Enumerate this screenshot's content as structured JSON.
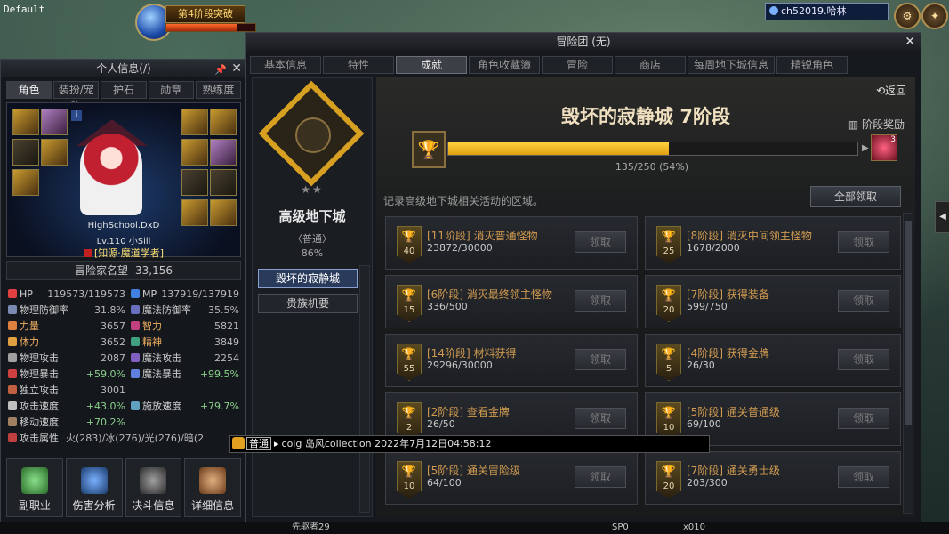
{
  "hud": {
    "profile": "Default",
    "banner": "第4阶段突破",
    "server": "ch52019.哈林"
  },
  "char_panel": {
    "title": "个人信息(/)",
    "tabs": [
      "角色",
      "装扮/宠物",
      "护石",
      "勋章",
      "熟练度"
    ],
    "name": "HighSchool.DxD",
    "level": "Lv.110 小Sill",
    "char_title": "[知源·魔道学者]",
    "fame_label": "冒险家名望",
    "fame_value": "33,156",
    "stats": [
      {
        "label": "HP",
        "value": "119573/119573",
        "icon": "heart-icon"
      },
      {
        "label": "MP",
        "value": "137919/137919",
        "icon": "mana-icon"
      },
      {
        "label": "物理防御率",
        "value": "31.8%",
        "icon": "shield-icon"
      },
      {
        "label": "魔法防御率",
        "value": "35.5%",
        "icon": "magic-shield-icon"
      },
      {
        "label": "力量",
        "value": "3657",
        "icon": "strength-icon"
      },
      {
        "label": "智力",
        "value": "5821",
        "icon": "intelligence-icon"
      },
      {
        "label": "体力",
        "value": "3652",
        "icon": "vitality-icon"
      },
      {
        "label": "精神",
        "value": "3849",
        "icon": "spirit-icon"
      },
      {
        "label": "物理攻击",
        "value": "2087",
        "icon": "sword-icon"
      },
      {
        "label": "魔法攻击",
        "value": "2254",
        "icon": "staff-icon"
      },
      {
        "label": "物理暴击",
        "value": "+59.0%",
        "icon": "crit-icon"
      },
      {
        "label": "魔法暴击",
        "value": "+99.5%",
        "icon": "magic-crit-icon"
      },
      {
        "label": "独立攻击",
        "value": "3001",
        "icon": "independent-attack-icon"
      },
      {
        "label": "",
        "value": "",
        "icon": ""
      },
      {
        "label": "攻击速度",
        "value": "+43.0%",
        "icon": "attack-speed-icon"
      },
      {
        "label": "施放速度",
        "value": "+79.7%",
        "icon": "cast-speed-icon"
      },
      {
        "label": "移动速度",
        "value": "+70.2%",
        "icon": "move-speed-icon"
      },
      {
        "label": "",
        "value": "",
        "icon": ""
      }
    ],
    "element_label": "攻击属性",
    "element_value": "火(283)/冰(276)/光(276)/暗(2",
    "buttons": [
      "副职业",
      "伤害分析",
      "决斗信息",
      "详细信息"
    ]
  },
  "adventure": {
    "title": "冒险团 (无)",
    "tabs": [
      "基本信息",
      "特性",
      "成就",
      "角色收藏簿",
      "冒险",
      "商店",
      "每周地下城信息",
      "精锐角色"
    ],
    "active_tab": "成就",
    "sidebar": {
      "category": "高级地下城",
      "stars": "★★",
      "difficulty": "〈普通〉",
      "percent": "86%",
      "items": [
        "毁坏的寂静城",
        "贵族机要"
      ]
    },
    "back": "⟲返回",
    "heading": "毁坏的寂静城 7阶段",
    "stage_reward": "阶段奖励",
    "progress_current": 135,
    "progress_total": 250,
    "progress_text": "135/250 (54%)",
    "reward_count": "3",
    "description": "记录高级地下城相关活动的区域。",
    "claim_all": "全部领取",
    "tasks": [
      {
        "name": "[11阶段] 消灭普通怪物",
        "progress": "23872/30000",
        "points": "40",
        "button": "领取"
      },
      {
        "name": "[8阶段] 消灭中间领主怪物",
        "progress": "1678/2000",
        "points": "25",
        "button": "领取"
      },
      {
        "name": "[6阶段] 消灭最终领主怪物",
        "progress": "336/500",
        "points": "15",
        "button": "领取"
      },
      {
        "name": "[7阶段] 获得装备",
        "progress": "599/750",
        "points": "20",
        "button": "领取"
      },
      {
        "name": "[14阶段] 材料获得",
        "progress": "29296/30000",
        "points": "55",
        "button": "领取"
      },
      {
        "name": "[4阶段] 获得金牌",
        "progress": "26/30",
        "points": "5",
        "button": "领取"
      },
      {
        "name": "[2阶段] 查看金牌",
        "progress": "26/50",
        "points": "2",
        "button": "领取"
      },
      {
        "name": "[5阶段] 通关普通级",
        "progress": "69/100",
        "points": "10",
        "button": "领取"
      },
      {
        "name": "[5阶段] 通关冒险级",
        "progress": "64/100",
        "points": "10",
        "button": "领取"
      },
      {
        "name": "[7阶段] 通关勇士级",
        "progress": "203/300",
        "points": "20",
        "button": "领取"
      }
    ]
  },
  "chat": {
    "channel": "普通",
    "message": "colg 岛风collection 2022年7月12日04:58:12"
  },
  "bottom": {
    "left": "先驱者29",
    "mid": "SP0",
    "right": "x010"
  },
  "colors": {
    "gold": "#d8a020",
    "progress": "#ffd040",
    "task_name": "#d09a50",
    "positive": "#8ad08a"
  }
}
